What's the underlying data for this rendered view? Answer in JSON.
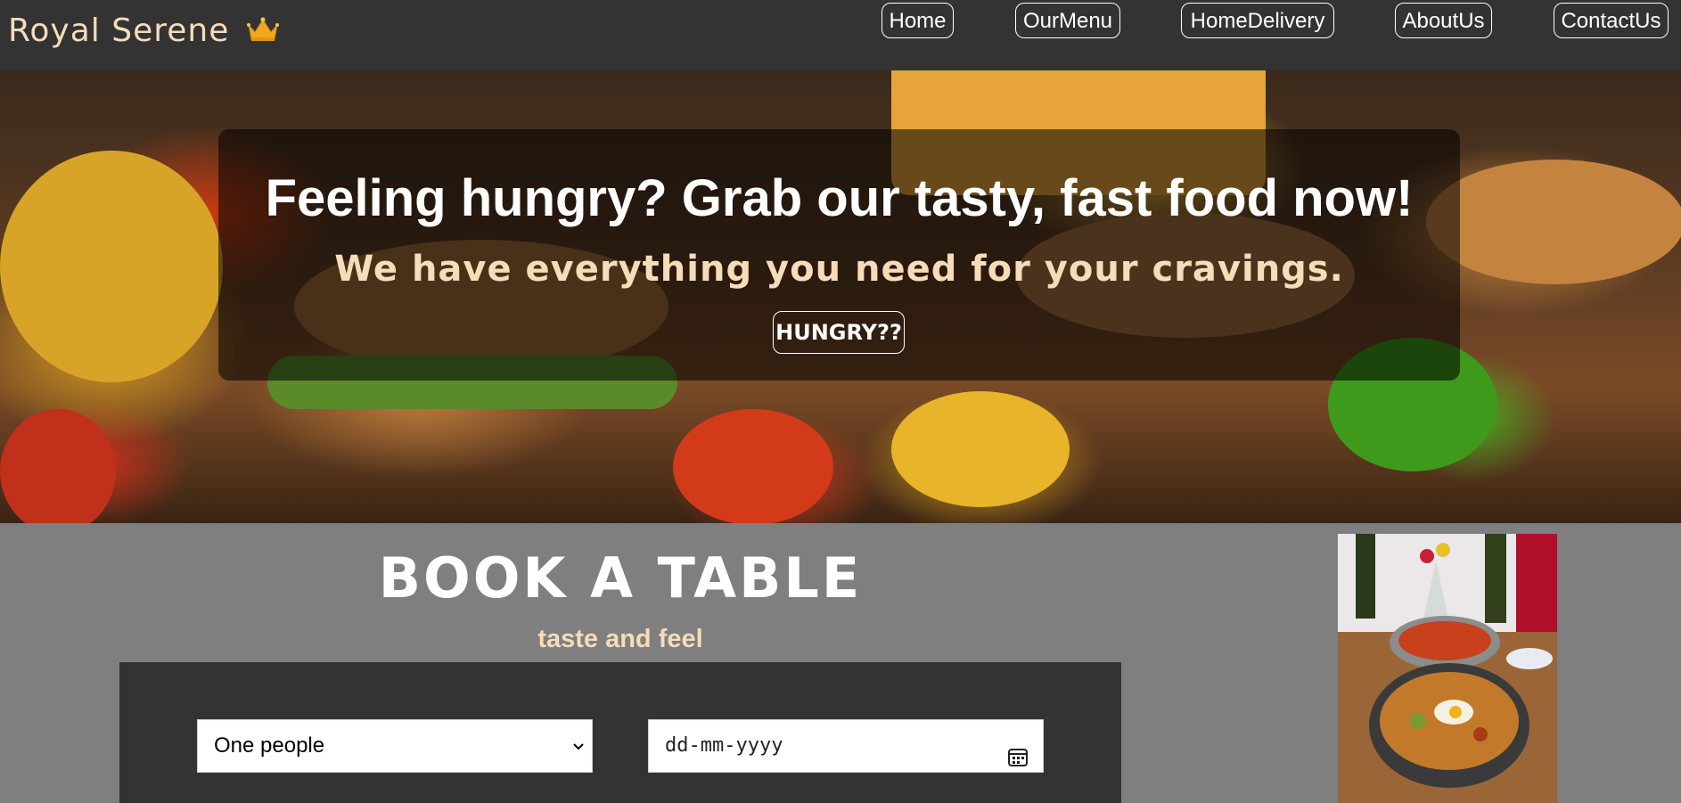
{
  "brand": {
    "name": "Royal Serene",
    "icon": "crown-icon"
  },
  "nav": {
    "items": [
      {
        "label": "Home"
      },
      {
        "label": "OurMenu"
      },
      {
        "label": "HomeDelivery"
      },
      {
        "label": "AboutUs"
      },
      {
        "label": "ContactUs"
      }
    ]
  },
  "hero": {
    "title": "Feeling hungry? Grab our tasty, fast food now!",
    "subtitle": "We have everything you need for your cravings.",
    "button": "HUNGRY??"
  },
  "booking": {
    "title": "BOOK A TABLE",
    "subtitle": "taste and feel",
    "people_select": {
      "value": "One people"
    },
    "date_input": {
      "placeholder": "dd-mm-yyyy"
    }
  },
  "colors": {
    "navbar": "#333333",
    "page_bg": "#7f7f7f",
    "accent": "#f6dcb8"
  }
}
